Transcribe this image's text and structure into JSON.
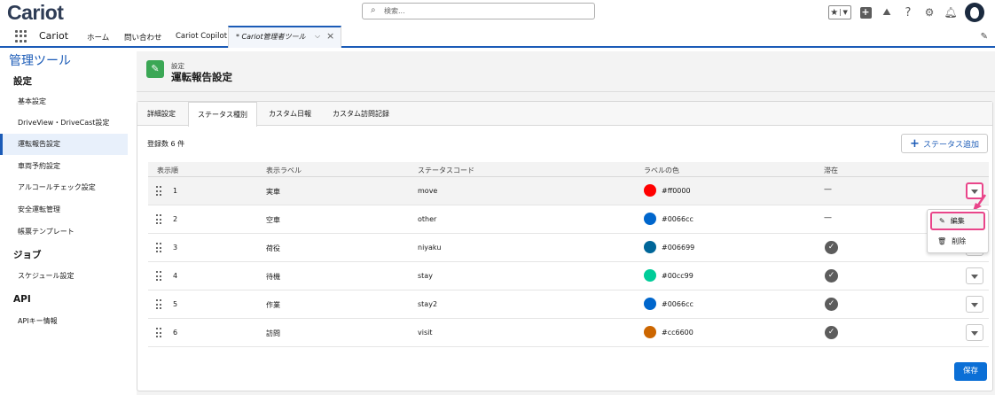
{
  "app": {
    "logo": "Cariot",
    "name": "Cariot"
  },
  "search": {
    "placeholder": "検索..."
  },
  "nav": {
    "items": [
      "ホーム",
      "問い合わせ",
      "Cariot Copilot"
    ],
    "active_tab": "* Cariot管理者ツール"
  },
  "sidebar": {
    "title": "管理ツール",
    "sections": [
      {
        "heading": "設定",
        "items": [
          "基本設定",
          "DriveView・DriveCast設定",
          "運転報告設定",
          "車両予約設定",
          "アルコールチェック設定",
          "安全運転管理",
          "帳票テンプレート"
        ]
      },
      {
        "heading": "ジョブ",
        "items": [
          "スケジュール設定"
        ]
      },
      {
        "heading": "API",
        "items": [
          "APIキー情報"
        ]
      }
    ],
    "active_item": "運転報告設定"
  },
  "header": {
    "subtitle": "設定",
    "title": "運転報告設定"
  },
  "tabs": [
    "詳細設定",
    "ステータス種別",
    "カスタム日報",
    "カスタム訪問記録"
  ],
  "active_tab_index": 1,
  "count_label": "登録数 6 件",
  "add_button": "ステータス追加",
  "table": {
    "columns": [
      "表示順",
      "表示ラベル",
      "ステータスコード",
      "ラベルの色",
      "滞在"
    ],
    "rows": [
      {
        "order": "1",
        "label": "実車",
        "code": "move",
        "color": "#ff0000",
        "stay": "—"
      },
      {
        "order": "2",
        "label": "空車",
        "code": "other",
        "color": "#0066cc",
        "stay": "—"
      },
      {
        "order": "3",
        "label": "荷役",
        "code": "niyaku",
        "color": "#006699",
        "stay": "check"
      },
      {
        "order": "4",
        "label": "待機",
        "code": "stay",
        "color": "#00cc99",
        "stay": "check"
      },
      {
        "order": "5",
        "label": "作業",
        "code": "stay2",
        "color": "#0066cc",
        "stay": "check"
      },
      {
        "order": "6",
        "label": "訪問",
        "code": "visit",
        "color": "#cc6600",
        "stay": "check"
      }
    ]
  },
  "row_menu": {
    "edit": "編集",
    "delete": "削除"
  },
  "save_button": "保存",
  "colors": {
    "brand": "#1b5bb7",
    "highlight": "#e9458a",
    "save": "#0b6fd6",
    "header_icon": "#3ba755"
  }
}
